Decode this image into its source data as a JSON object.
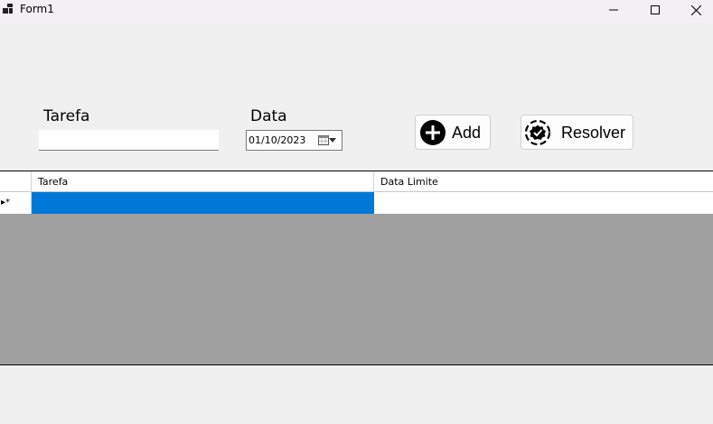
{
  "window": {
    "title": "Form1",
    "controls": [
      "minimize-icon",
      "maximize-icon",
      "close-icon"
    ]
  },
  "form": {
    "tarefa_label": "Tarefa",
    "tarefa_value": "",
    "data_label": "Data",
    "data_value": "01/10/2023",
    "add_button_label": "Add",
    "add_button_icon": "plus-circle-icon",
    "resolver_button_label": "Resolver",
    "resolver_button_icon": "verified-badge-icon"
  },
  "grid": {
    "columns": [
      "Tarefa",
      "Data Limite"
    ],
    "new_row_marker": "▸*",
    "rows": [
      {
        "tarefa": "",
        "data_limite": ""
      }
    ],
    "colors": {
      "selection": "#0078d7",
      "background": "#a0a0a0"
    }
  }
}
